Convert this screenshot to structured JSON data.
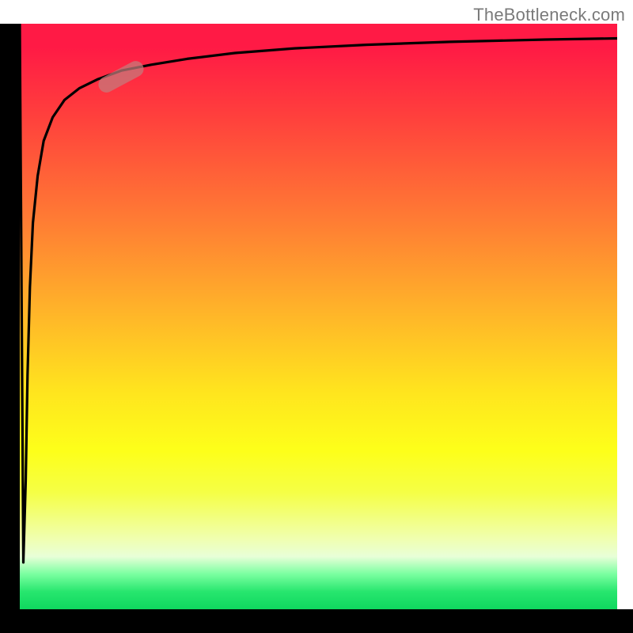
{
  "watermark": "TheBottleneck.com",
  "colors": {
    "gradient_top": "#ff1a45",
    "gradient_bottom": "#0fd85f",
    "axis": "#000000",
    "curve": "#000000",
    "marker": "rgba(195,125,125,0.72)"
  },
  "chart_data": {
    "type": "line",
    "title": "",
    "xlabel": "",
    "ylabel": "",
    "xlim": [
      0,
      100
    ],
    "ylim": [
      0,
      100
    ],
    "series": [
      {
        "name": "bottleneck-curve",
        "x": [
          0,
          0.6,
          1.0,
          1.3,
          1.7,
          2.2,
          3.0,
          4.0,
          5.5,
          7.5,
          10.0,
          13.0,
          17.0,
          22.0,
          28.0,
          36.0,
          46.0,
          58.0,
          72.0,
          88.0,
          100.0
        ],
        "y": [
          100,
          8,
          22,
          40,
          55,
          66,
          74,
          80,
          84,
          87,
          89,
          90.5,
          92,
          93,
          94,
          95,
          95.8,
          96.4,
          96.9,
          97.3,
          97.5
        ]
      }
    ],
    "marker": {
      "x_center": 17,
      "y_center": 91,
      "angle_deg": -28
    },
    "notes": "Axes show no numeric tick labels in the source image; values are estimated on a 0–100 normalized scale. Background gradient encodes a secondary variable from red (top) through orange/yellow to green (bottom)."
  }
}
